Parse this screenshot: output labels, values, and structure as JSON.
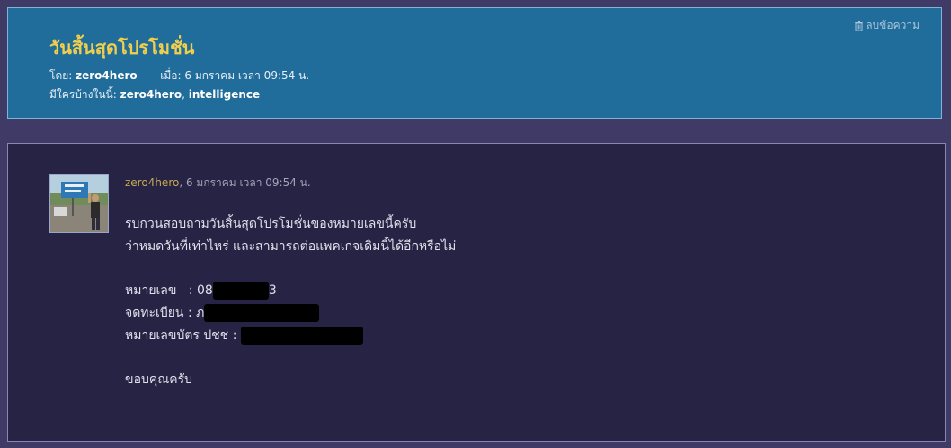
{
  "header": {
    "title": "วันสิ้นสุดโปรโมชั่น",
    "by_label": "โดย:",
    "author": "zero4hero",
    "when_label": "เมื่อ:",
    "when": "6 มกราคม เวลา 09:54 น.",
    "participants_label": "มีใครบ้างในนี้:",
    "participant_1": "zero4hero",
    "participant_sep": ",",
    "participant_2": "intelligence",
    "delete_label": "ลบข้อความ",
    "delete_icon": "trash-icon"
  },
  "post": {
    "author": "zero4hero",
    "timestamp": ", 6 มกราคม เวลา 09:54 น.",
    "line1": "รบกวนสอบถามวันสิ้นสุดโปรโมชั่นของหมายเลขนี้ครับ",
    "line2": "ว่าหมดวันที่เท่าไหร่ และสามารถต่อแพคเกจเดิมนี้ได้อีกหรือไม่",
    "number_label": "หมายเลข   : ",
    "number_value_visible": "08",
    "number_value_tail": "3",
    "registered_label": "จดทะเบียน : ",
    "registered_value_visible": "ภ",
    "idcard_label": "หมายเลขบัตร ปชช : ",
    "thanks": "ขอบคุณครับ"
  },
  "colors": {
    "page_bg": "#3f3b66",
    "header_bg": "#206c9a",
    "title": "#f0cf4c",
    "post_bg": "#262344",
    "author_link": "#c6a852"
  }
}
